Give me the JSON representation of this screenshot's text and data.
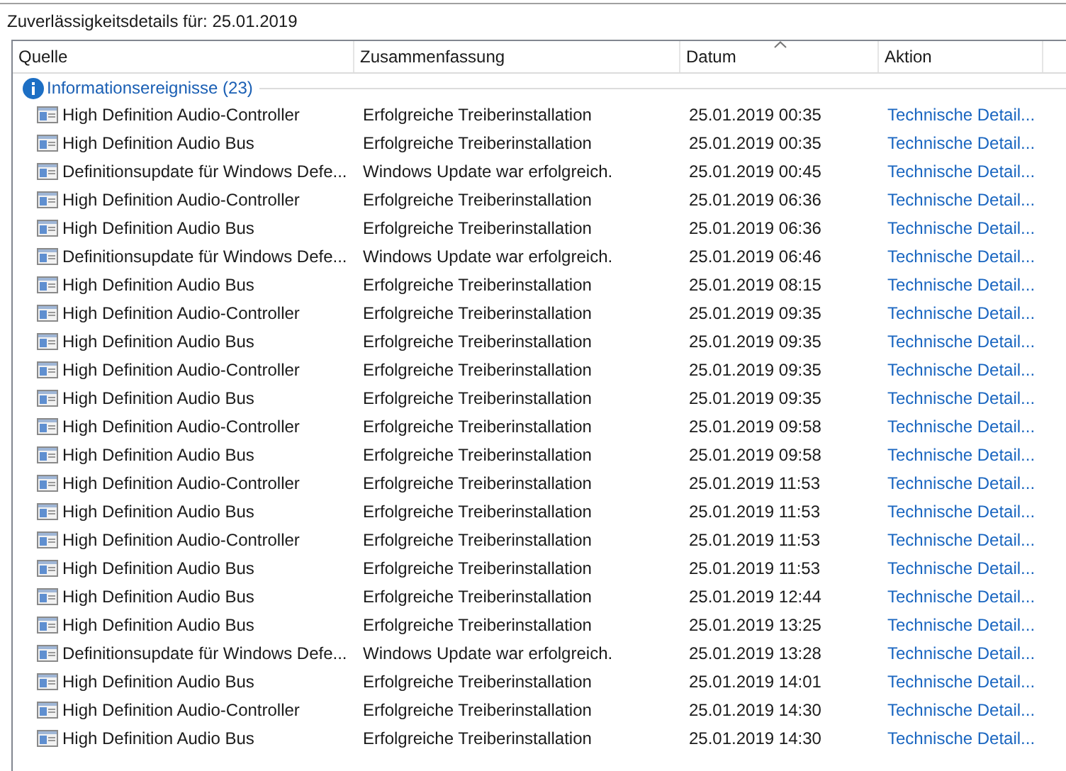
{
  "title": "Zuverlässigkeitsdetails für: 25.01.2019",
  "table": {
    "columns": [
      {
        "label": "Quelle",
        "sorted": false
      },
      {
        "label": "Zusammenfassung",
        "sorted": false
      },
      {
        "label": "Datum",
        "sorted": true
      },
      {
        "label": "Aktion",
        "sorted": false
      }
    ],
    "group": {
      "label": "Informationsereignisse (23)"
    },
    "rows": [
      {
        "source": "High Definition Audio-Controller",
        "summary": "Erfolgreiche Treiberinstallation",
        "date": "25.01.2019 00:35",
        "action": "Technische Detail..."
      },
      {
        "source": "High Definition Audio Bus",
        "summary": "Erfolgreiche Treiberinstallation",
        "date": "25.01.2019 00:35",
        "action": "Technische Detail..."
      },
      {
        "source": "Definitionsupdate für Windows Defe...",
        "summary": "Windows Update war erfolgreich.",
        "date": "25.01.2019 00:45",
        "action": "Technische Detail..."
      },
      {
        "source": "High Definition Audio-Controller",
        "summary": "Erfolgreiche Treiberinstallation",
        "date": "25.01.2019 06:36",
        "action": "Technische Detail..."
      },
      {
        "source": "High Definition Audio Bus",
        "summary": "Erfolgreiche Treiberinstallation",
        "date": "25.01.2019 06:36",
        "action": "Technische Detail..."
      },
      {
        "source": "Definitionsupdate für Windows Defe...",
        "summary": "Windows Update war erfolgreich.",
        "date": "25.01.2019 06:46",
        "action": "Technische Detail..."
      },
      {
        "source": "High Definition Audio Bus",
        "summary": "Erfolgreiche Treiberinstallation",
        "date": "25.01.2019 08:15",
        "action": "Technische Detail..."
      },
      {
        "source": "High Definition Audio-Controller",
        "summary": "Erfolgreiche Treiberinstallation",
        "date": "25.01.2019 09:35",
        "action": "Technische Detail..."
      },
      {
        "source": "High Definition Audio Bus",
        "summary": "Erfolgreiche Treiberinstallation",
        "date": "25.01.2019 09:35",
        "action": "Technische Detail..."
      },
      {
        "source": "High Definition Audio-Controller",
        "summary": "Erfolgreiche Treiberinstallation",
        "date": "25.01.2019 09:35",
        "action": "Technische Detail..."
      },
      {
        "source": "High Definition Audio Bus",
        "summary": "Erfolgreiche Treiberinstallation",
        "date": "25.01.2019 09:35",
        "action": "Technische Detail..."
      },
      {
        "source": "High Definition Audio-Controller",
        "summary": "Erfolgreiche Treiberinstallation",
        "date": "25.01.2019 09:58",
        "action": "Technische Detail..."
      },
      {
        "source": "High Definition Audio Bus",
        "summary": "Erfolgreiche Treiberinstallation",
        "date": "25.01.2019 09:58",
        "action": "Technische Detail..."
      },
      {
        "source": "High Definition Audio-Controller",
        "summary": "Erfolgreiche Treiberinstallation",
        "date": "25.01.2019 11:53",
        "action": "Technische Detail..."
      },
      {
        "source": "High Definition Audio Bus",
        "summary": "Erfolgreiche Treiberinstallation",
        "date": "25.01.2019 11:53",
        "action": "Technische Detail..."
      },
      {
        "source": "High Definition Audio-Controller",
        "summary": "Erfolgreiche Treiberinstallation",
        "date": "25.01.2019 11:53",
        "action": "Technische Detail..."
      },
      {
        "source": "High Definition Audio Bus",
        "summary": "Erfolgreiche Treiberinstallation",
        "date": "25.01.2019 11:53",
        "action": "Technische Detail..."
      },
      {
        "source": "High Definition Audio Bus",
        "summary": "Erfolgreiche Treiberinstallation",
        "date": "25.01.2019 12:44",
        "action": "Technische Detail..."
      },
      {
        "source": "High Definition Audio Bus",
        "summary": "Erfolgreiche Treiberinstallation",
        "date": "25.01.2019 13:25",
        "action": "Technische Detail..."
      },
      {
        "source": "Definitionsupdate für Windows Defe...",
        "summary": "Windows Update war erfolgreich.",
        "date": "25.01.2019 13:28",
        "action": "Technische Detail..."
      },
      {
        "source": "High Definition Audio Bus",
        "summary": "Erfolgreiche Treiberinstallation",
        "date": "25.01.2019 14:01",
        "action": "Technische Detail..."
      },
      {
        "source": "High Definition Audio-Controller",
        "summary": "Erfolgreiche Treiberinstallation",
        "date": "25.01.2019 14:30",
        "action": "Technische Detail..."
      },
      {
        "source": "High Definition Audio Bus",
        "summary": "Erfolgreiche Treiberinstallation",
        "date": "25.01.2019 14:30",
        "action": "Technische Detail..."
      }
    ]
  }
}
